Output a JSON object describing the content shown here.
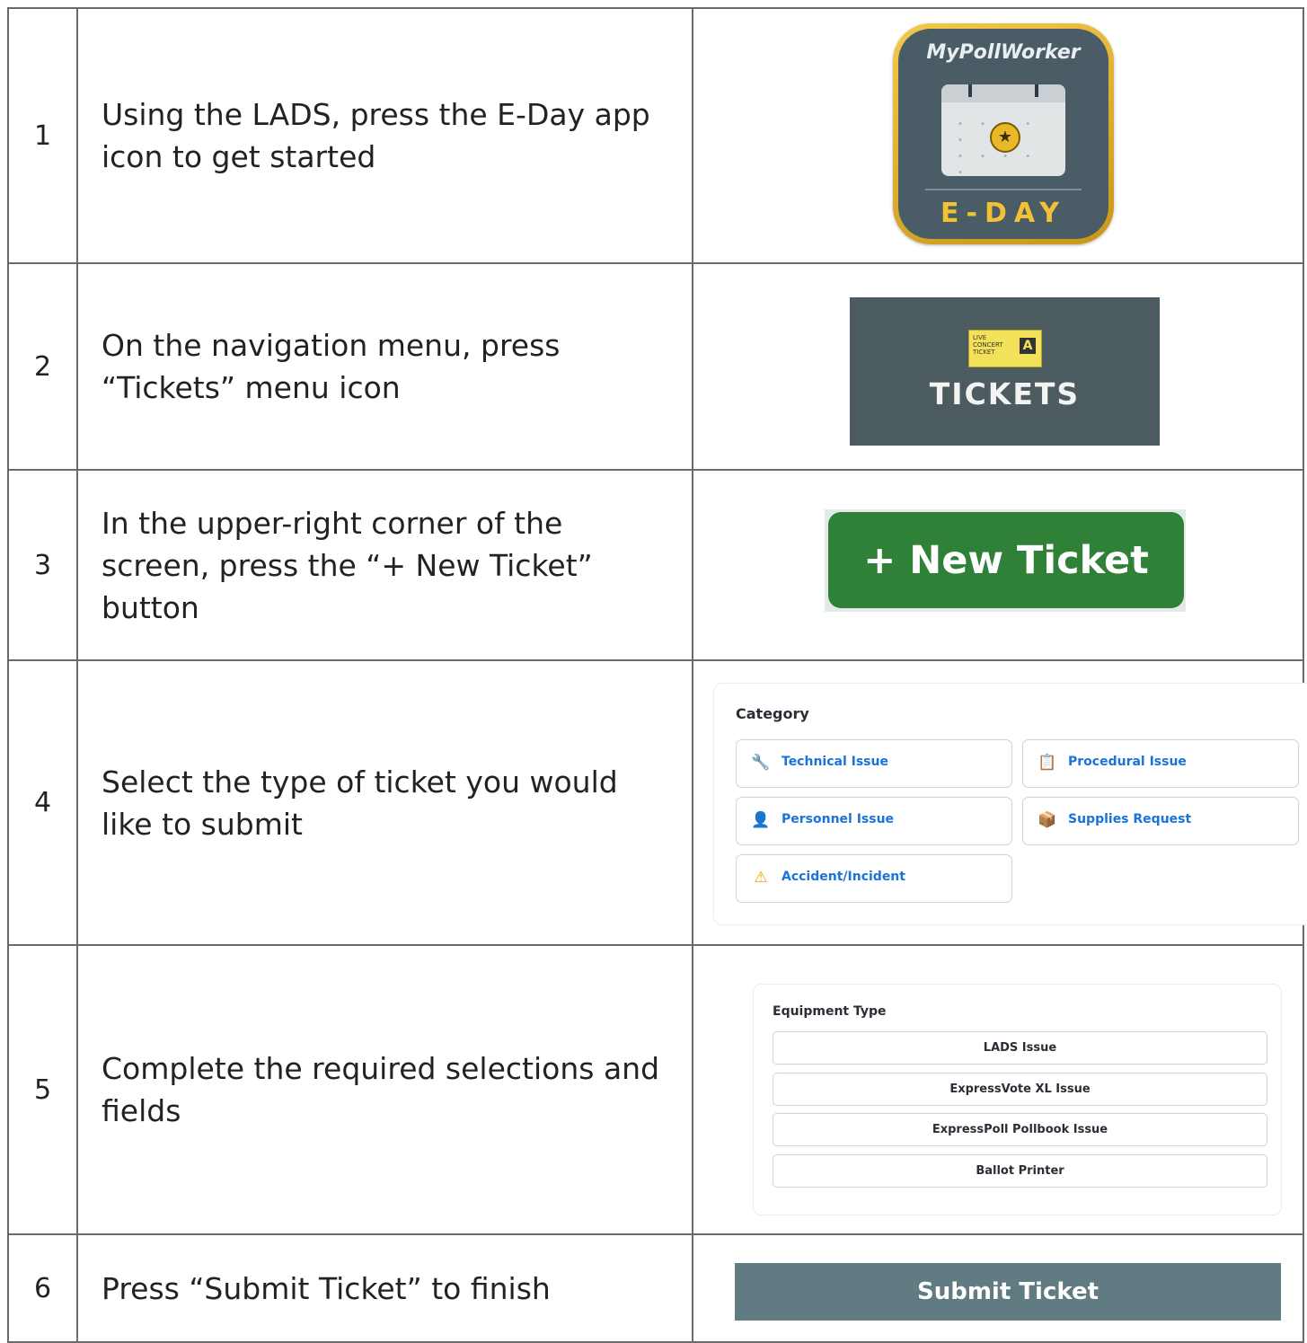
{
  "steps": [
    {
      "number": "1",
      "instruction": "Using the LADS, press the E-Day app icon to get started"
    },
    {
      "number": "2",
      "instruction": "On the navigation menu, press “Tickets” menu icon"
    },
    {
      "number": "3",
      "instruction": "In the upper-right corner of the screen, press the “+ New Ticket” button"
    },
    {
      "number": "4",
      "instruction": "Select the type of ticket you would like to submit"
    },
    {
      "number": "5",
      "instruction": "Complete the required selections and fields"
    },
    {
      "number": "6",
      "instruction": "Press “Submit Ticket” to finish"
    }
  ],
  "eday_icon": {
    "title": "MyPollWorker",
    "label": "E-DAY",
    "icon": "calendar-star-icon"
  },
  "tickets_icon": {
    "label": "TICKETS",
    "icon": "ticket-icon"
  },
  "new_ticket_button": {
    "label": "+ New Ticket",
    "color": "#2e8137"
  },
  "category": {
    "label": "Category",
    "options": [
      {
        "label": "Technical Issue",
        "icon": "wrench-icon"
      },
      {
        "label": "Procedural Issue",
        "icon": "clipboard-icon"
      },
      {
        "label": "Personnel Issue",
        "icon": "person-icon"
      },
      {
        "label": "Supplies Request",
        "icon": "package-icon"
      },
      {
        "label": "Accident/Incident",
        "icon": "warning-icon"
      }
    ],
    "link_color": "#1a73d9"
  },
  "equipment": {
    "label": "Equipment Type",
    "options": [
      "LADS Issue",
      "ExpressVote XL Issue",
      "ExpressPoll Pollbook Issue",
      "Ballot Printer"
    ]
  },
  "submit_button": {
    "label": "Submit Ticket",
    "color": "#607b82"
  }
}
